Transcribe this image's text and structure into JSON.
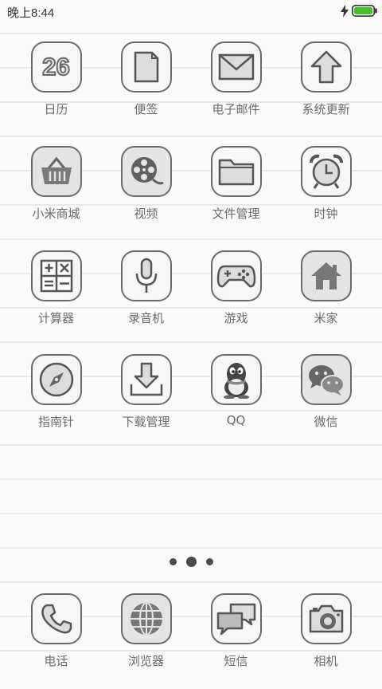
{
  "status_bar": {
    "time": "晚上8:44",
    "battery_color": "#45c22a"
  },
  "home": {
    "apps": [
      {
        "label": "日历",
        "icon": "calendar-icon",
        "badge": "26"
      },
      {
        "label": "便签",
        "icon": "notes-icon"
      },
      {
        "label": "电子邮件",
        "icon": "email-icon"
      },
      {
        "label": "系统更新",
        "icon": "system-update-icon"
      },
      {
        "label": "小米商城",
        "icon": "shopping-basket-icon"
      },
      {
        "label": "视频",
        "icon": "video-reel-icon"
      },
      {
        "label": "文件管理",
        "icon": "folder-icon"
      },
      {
        "label": "时钟",
        "icon": "alarm-clock-icon"
      },
      {
        "label": "计算器",
        "icon": "calculator-icon"
      },
      {
        "label": "录音机",
        "icon": "microphone-icon"
      },
      {
        "label": "游戏",
        "icon": "gamepad-icon"
      },
      {
        "label": "米家",
        "icon": "home-icon"
      },
      {
        "label": "指南针",
        "icon": "compass-icon"
      },
      {
        "label": "下载管理",
        "icon": "download-icon"
      },
      {
        "label": "QQ",
        "icon": "qq-penguin-icon"
      },
      {
        "label": "微信",
        "icon": "wechat-icon"
      }
    ]
  },
  "page_indicator": {
    "pages": 3,
    "current_page": 2
  },
  "dock": {
    "apps": [
      {
        "label": "电话",
        "icon": "phone-icon"
      },
      {
        "label": "浏览器",
        "icon": "globe-icon"
      },
      {
        "label": "短信",
        "icon": "messages-icon"
      },
      {
        "label": "相机",
        "icon": "camera-icon"
      }
    ]
  }
}
